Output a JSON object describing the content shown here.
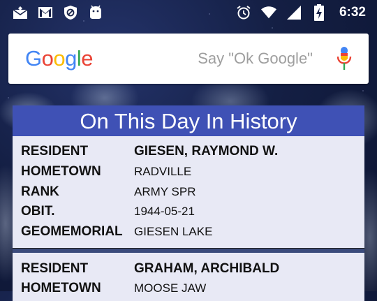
{
  "status_bar": {
    "left_icons": [
      "email-alt-icon",
      "gmail-icon",
      "blocked-icon",
      "android-icon"
    ],
    "right_icons": [
      "alarm-icon",
      "wifi-icon",
      "signal-icon",
      "battery-charging-icon"
    ],
    "time": "6:32"
  },
  "search": {
    "logo": "Google",
    "hint": "Say \"Ok Google\""
  },
  "history": {
    "title": "On This Day In History",
    "records": [
      {
        "resident_label": "RESIDENT",
        "resident": "GIESEN, RAYMOND W.",
        "hometown_label": "HOMETOWN",
        "hometown": "RADVILLE",
        "rank_label": "RANK",
        "rank": "ARMY SPR",
        "obit_label": "OBIT.",
        "obit": "1944-05-21",
        "geo_label": "GEOMEMORIAL",
        "geo": "GIESEN LAKE"
      },
      {
        "resident_label": "RESIDENT",
        "resident": "GRAHAM, ARCHIBALD",
        "hometown_label": "HOMETOWN",
        "hometown": "MOOSE JAW"
      }
    ]
  },
  "colors": {
    "accent": "#3f51b5",
    "card_bg": "#e8e9f5",
    "google_blue": "#4285F4",
    "google_red": "#EA4335",
    "google_yellow": "#FBBC05",
    "google_green": "#34A853"
  }
}
